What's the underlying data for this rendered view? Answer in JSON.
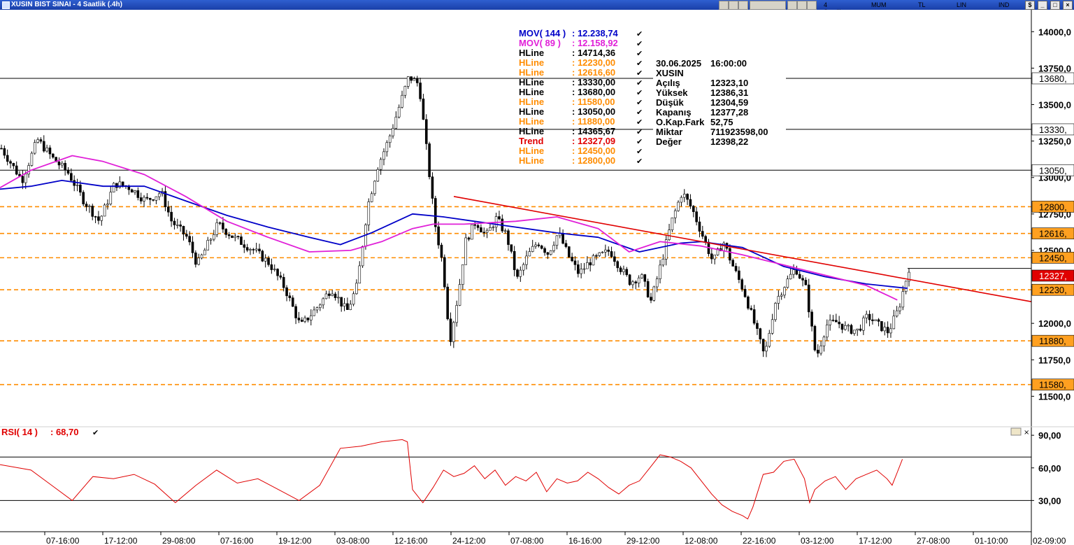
{
  "window": {
    "title": "XUSIN BIST SINAI - 4 Saatlik (.4h)",
    "toolbar": {
      "period": "4 Saatlik",
      "chart_type": "MUM",
      "currency": "TL",
      "scale": "LIN",
      "indicators": "IND"
    }
  },
  "price_axis": {
    "ticks": [
      "14000,0",
      "13750,0",
      "13500,0",
      "13250,0",
      "13000,0",
      "12750,0",
      "12500,0",
      "12250,0",
      "12000,0",
      "11750,0",
      "11500,0"
    ],
    "tick_values": [
      14000,
      13750,
      13500,
      13250,
      13000,
      12750,
      12500,
      12250,
      12000,
      11750,
      11500
    ],
    "level_tags": [
      {
        "label": "13680,",
        "value": 13680,
        "color": "#000000",
        "bg": "#ffffff"
      },
      {
        "label": "13330,",
        "value": 13330,
        "color": "#000000",
        "bg": "#ffffff"
      },
      {
        "label": "13050,",
        "value": 13050,
        "color": "#000000",
        "bg": "#ffffff"
      },
      {
        "label": "12800,",
        "value": 12800,
        "color": "#000000",
        "bg": "#ffa020"
      },
      {
        "label": "12616,",
        "value": 12616.6,
        "color": "#000000",
        "bg": "#ffa020"
      },
      {
        "label": "12450,",
        "value": 12450,
        "color": "#000000",
        "bg": "#ffa020"
      },
      {
        "label": "12327,",
        "value": 12327.09,
        "color": "#000000",
        "bg": "#e00000"
      },
      {
        "label": "12230,",
        "value": 12230,
        "color": "#000000",
        "bg": "#ffa020"
      },
      {
        "label": "11880,",
        "value": 11880,
        "color": "#000000",
        "bg": "#ffa020"
      },
      {
        "label": "11580,",
        "value": 11580,
        "color": "#000000",
        "bg": "#ffa020"
      }
    ]
  },
  "time_axis": {
    "labels": [
      "07-16:00",
      "17-12:00",
      "29-08:00",
      "07-16:00",
      "19-12:00",
      "03-08:00",
      "12-16:00",
      "24-12:00",
      "07-08:00",
      "16-16:00",
      "29-12:00",
      "12-08:00",
      "22-16:00",
      "03-12:00",
      "17-12:00",
      "27-08:00",
      "01-10:00",
      "02-09:00"
    ]
  },
  "legend": [
    {
      "name": "MOV( 144 )",
      "value": ": 12.238,74",
      "color": "#0000c8"
    },
    {
      "name": "MOV( 89 )",
      "value": ": 12.158,92",
      "color": "#e020d8"
    },
    {
      "name": "HLine",
      "value": ": 14714,36",
      "color": "#000000"
    },
    {
      "name": "HLine",
      "value": ": 12230,00",
      "color": "#ff8c00"
    },
    {
      "name": "HLine",
      "value": ": 12616,60",
      "color": "#ff8c00"
    },
    {
      "name": "HLine",
      "value": ": 13330,00",
      "color": "#000000"
    },
    {
      "name": "HLine",
      "value": ": 13680,00",
      "color": "#000000"
    },
    {
      "name": "HLine",
      "value": ": 11580,00",
      "color": "#ff8c00"
    },
    {
      "name": "HLine",
      "value": ": 13050,00",
      "color": "#000000"
    },
    {
      "name": "HLine",
      "value": ": 11880,00",
      "color": "#ff8c00"
    },
    {
      "name": "HLine",
      "value": ": 14365,67",
      "color": "#000000"
    },
    {
      "name": "Trend",
      "value": ": 12327,09",
      "color": "#e00000"
    },
    {
      "name": "HLine",
      "value": ": 12450,00",
      "color": "#ff8c00"
    },
    {
      "name": "HLine",
      "value": ": 12800,00",
      "color": "#ff8c00"
    }
  ],
  "info_box": {
    "date": "30.06.2025",
    "time": "16:00:00",
    "symbol": "XUSIN",
    "rows": [
      {
        "label": "Açılış",
        "value": "12323,10"
      },
      {
        "label": "Yüksek",
        "value": "12386,31"
      },
      {
        "label": "Düşük",
        "value": "12304,59"
      },
      {
        "label": "Kapanış",
        "value": "12377,28"
      },
      {
        "label": "O.Kap.Fark",
        "value": "52,75"
      },
      {
        "label": "Miktar",
        "value": "711923598,00"
      },
      {
        "label": "Değer",
        "value": "12398,22"
      }
    ]
  },
  "rsi_panel": {
    "label": "RSI( 14 )",
    "value": ": 68,70",
    "ticks": [
      "90,00",
      "60,00",
      "30,00"
    ],
    "tick_values": [
      90,
      60,
      30
    ],
    "bands": [
      70,
      30
    ]
  },
  "colors": {
    "up_candle": "#ffffff",
    "candle_line": "#000000",
    "mov144": "#0000c8",
    "mov89": "#e020d8",
    "trend": "#e00000",
    "orange": "#ff8c00",
    "rsi": "#e00000"
  },
  "chart_data": {
    "type": "candlestick",
    "title": "XUSIN BIST SINAI - 4 Saatlik (.4h)",
    "ylim": [
      11310,
      14150
    ],
    "horizontal_lines": [
      {
        "value": 13680,
        "style": "solid",
        "color": "#000000"
      },
      {
        "value": 13330,
        "style": "solid",
        "color": "#000000"
      },
      {
        "value": 13050,
        "style": "solid",
        "color": "#000000"
      },
      {
        "value": 12800,
        "style": "dashed",
        "color": "#ff8c00"
      },
      {
        "value": 12616.6,
        "style": "dashed",
        "color": "#ff8c00"
      },
      {
        "value": 12450,
        "style": "dashed",
        "color": "#ff8c00"
      },
      {
        "value": 12230,
        "style": "dashed",
        "color": "#ff8c00"
      },
      {
        "value": 11880,
        "style": "dashed",
        "color": "#ff8c00"
      },
      {
        "value": 11580,
        "style": "dashed",
        "color": "#ff8c00"
      }
    ],
    "trend_line": {
      "from": {
        "bar": 0.44,
        "value": 12870
      },
      "to": {
        "bar": 0.96,
        "value": 12200
      }
    },
    "close_path": [
      [
        0,
        13200
      ],
      [
        0.02,
        12980
      ],
      [
        0.035,
        13260
      ],
      [
        0.05,
        13130
      ],
      [
        0.065,
        13030
      ],
      [
        0.08,
        12840
      ],
      [
        0.095,
        12700
      ],
      [
        0.11,
        12960
      ],
      [
        0.125,
        12930
      ],
      [
        0.14,
        12840
      ],
      [
        0.155,
        12900
      ],
      [
        0.165,
        12700
      ],
      [
        0.18,
        12590
      ],
      [
        0.19,
        12400
      ],
      [
        0.21,
        12680
      ],
      [
        0.225,
        12590
      ],
      [
        0.245,
        12500
      ],
      [
        0.26,
        12410
      ],
      [
        0.275,
        12240
      ],
      [
        0.29,
        11980
      ],
      [
        0.305,
        12100
      ],
      [
        0.32,
        12240
      ],
      [
        0.335,
        12080
      ],
      [
        0.345,
        12260
      ],
      [
        0.355,
        12800
      ],
      [
        0.365,
        13080
      ],
      [
        0.375,
        13250
      ],
      [
        0.385,
        13470
      ],
      [
        0.395,
        13690
      ],
      [
        0.405,
        13640
      ],
      [
        0.415,
        13020
      ],
      [
        0.42,
        12700
      ],
      [
        0.428,
        12400
      ],
      [
        0.435,
        11880
      ],
      [
        0.443,
        12200
      ],
      [
        0.45,
        12560
      ],
      [
        0.46,
        12700
      ],
      [
        0.47,
        12600
      ],
      [
        0.48,
        12720
      ],
      [
        0.49,
        12600
      ],
      [
        0.5,
        12300
      ],
      [
        0.51,
        12460
      ],
      [
        0.52,
        12560
      ],
      [
        0.53,
        12480
      ],
      [
        0.54,
        12620
      ],
      [
        0.55,
        12460
      ],
      [
        0.56,
        12340
      ],
      [
        0.57,
        12420
      ],
      [
        0.58,
        12460
      ],
      [
        0.59,
        12500
      ],
      [
        0.6,
        12380
      ],
      [
        0.61,
        12280
      ],
      [
        0.62,
        12330
      ],
      [
        0.63,
        12150
      ],
      [
        0.64,
        12420
      ],
      [
        0.65,
        12700
      ],
      [
        0.66,
        12900
      ],
      [
        0.67,
        12780
      ],
      [
        0.68,
        12600
      ],
      [
        0.69,
        12420
      ],
      [
        0.7,
        12560
      ],
      [
        0.71,
        12380
      ],
      [
        0.72,
        12220
      ],
      [
        0.73,
        12000
      ],
      [
        0.74,
        11770
      ],
      [
        0.75,
        12140
      ],
      [
        0.76,
        12270
      ],
      [
        0.77,
        12380
      ],
      [
        0.78,
        12240
      ],
      [
        0.79,
        11760
      ],
      [
        0.8,
        11990
      ],
      [
        0.81,
        12010
      ],
      [
        0.82,
        11960
      ],
      [
        0.83,
        11950
      ],
      [
        0.84,
        12050
      ],
      [
        0.85,
        11990
      ],
      [
        0.86,
        11940
      ],
      [
        0.87,
        12100
      ],
      [
        0.88,
        12380
      ]
    ],
    "mov144_path": [
      [
        0,
        12920
      ],
      [
        0.03,
        12940
      ],
      [
        0.06,
        12980
      ],
      [
        0.1,
        12940
      ],
      [
        0.14,
        12940
      ],
      [
        0.18,
        12840
      ],
      [
        0.22,
        12740
      ],
      [
        0.26,
        12660
      ],
      [
        0.3,
        12590
      ],
      [
        0.33,
        12540
      ],
      [
        0.36,
        12620
      ],
      [
        0.4,
        12750
      ],
      [
        0.43,
        12730
      ],
      [
        0.46,
        12700
      ],
      [
        0.5,
        12660
      ],
      [
        0.54,
        12620
      ],
      [
        0.58,
        12590
      ],
      [
        0.62,
        12490
      ],
      [
        0.66,
        12550
      ],
      [
        0.68,
        12560
      ],
      [
        0.72,
        12520
      ],
      [
        0.76,
        12390
      ],
      [
        0.8,
        12320
      ],
      [
        0.84,
        12270
      ],
      [
        0.88,
        12240
      ]
    ],
    "mov89_path": [
      [
        0,
        12930
      ],
      [
        0.03,
        13050
      ],
      [
        0.07,
        13150
      ],
      [
        0.1,
        13110
      ],
      [
        0.14,
        13020
      ],
      [
        0.18,
        12870
      ],
      [
        0.22,
        12700
      ],
      [
        0.26,
        12590
      ],
      [
        0.3,
        12490
      ],
      [
        0.34,
        12500
      ],
      [
        0.37,
        12560
      ],
      [
        0.4,
        12650
      ],
      [
        0.42,
        12680
      ],
      [
        0.45,
        12680
      ],
      [
        0.5,
        12700
      ],
      [
        0.54,
        12730
      ],
      [
        0.58,
        12650
      ],
      [
        0.61,
        12490
      ],
      [
        0.64,
        12560
      ],
      [
        0.68,
        12530
      ],
      [
        0.72,
        12470
      ],
      [
        0.76,
        12400
      ],
      [
        0.8,
        12330
      ],
      [
        0.84,
        12260
      ],
      [
        0.87,
        12160
      ]
    ],
    "rsi_series": [
      [
        0,
        63
      ],
      [
        0.03,
        58
      ],
      [
        0.05,
        44
      ],
      [
        0.07,
        30
      ],
      [
        0.09,
        52
      ],
      [
        0.11,
        50
      ],
      [
        0.13,
        54
      ],
      [
        0.15,
        45
      ],
      [
        0.17,
        28
      ],
      [
        0.19,
        44
      ],
      [
        0.21,
        58
      ],
      [
        0.23,
        46
      ],
      [
        0.25,
        50
      ],
      [
        0.27,
        40
      ],
      [
        0.29,
        30
      ],
      [
        0.31,
        44
      ],
      [
        0.33,
        78
      ],
      [
        0.35,
        80
      ],
      [
        0.37,
        84
      ],
      [
        0.39,
        86
      ],
      [
        0.395,
        84
      ],
      [
        0.4,
        40
      ],
      [
        0.41,
        28
      ],
      [
        0.42,
        42
      ],
      [
        0.43,
        58
      ],
      [
        0.44,
        52
      ],
      [
        0.45,
        55
      ],
      [
        0.46,
        62
      ],
      [
        0.47,
        50
      ],
      [
        0.48,
        58
      ],
      [
        0.49,
        44
      ],
      [
        0.5,
        52
      ],
      [
        0.51,
        48
      ],
      [
        0.52,
        56
      ],
      [
        0.53,
        38
      ],
      [
        0.54,
        50
      ],
      [
        0.55,
        46
      ],
      [
        0.56,
        48
      ],
      [
        0.57,
        56
      ],
      [
        0.58,
        50
      ],
      [
        0.59,
        42
      ],
      [
        0.6,
        36
      ],
      [
        0.61,
        44
      ],
      [
        0.62,
        48
      ],
      [
        0.63,
        60
      ],
      [
        0.64,
        72
      ],
      [
        0.65,
        70
      ],
      [
        0.66,
        66
      ],
      [
        0.67,
        60
      ],
      [
        0.68,
        48
      ],
      [
        0.69,
        36
      ],
      [
        0.7,
        26
      ],
      [
        0.71,
        20
      ],
      [
        0.72,
        16
      ],
      [
        0.725,
        13
      ],
      [
        0.73,
        24
      ],
      [
        0.74,
        54
      ],
      [
        0.75,
        56
      ],
      [
        0.76,
        66
      ],
      [
        0.77,
        68
      ],
      [
        0.78,
        50
      ],
      [
        0.785,
        28
      ],
      [
        0.79,
        40
      ],
      [
        0.8,
        48
      ],
      [
        0.81,
        52
      ],
      [
        0.82,
        40
      ],
      [
        0.83,
        50
      ],
      [
        0.84,
        54
      ],
      [
        0.85,
        58
      ],
      [
        0.86,
        50
      ],
      [
        0.865,
        44
      ],
      [
        0.87,
        56
      ],
      [
        0.875,
        68
      ]
    ]
  }
}
